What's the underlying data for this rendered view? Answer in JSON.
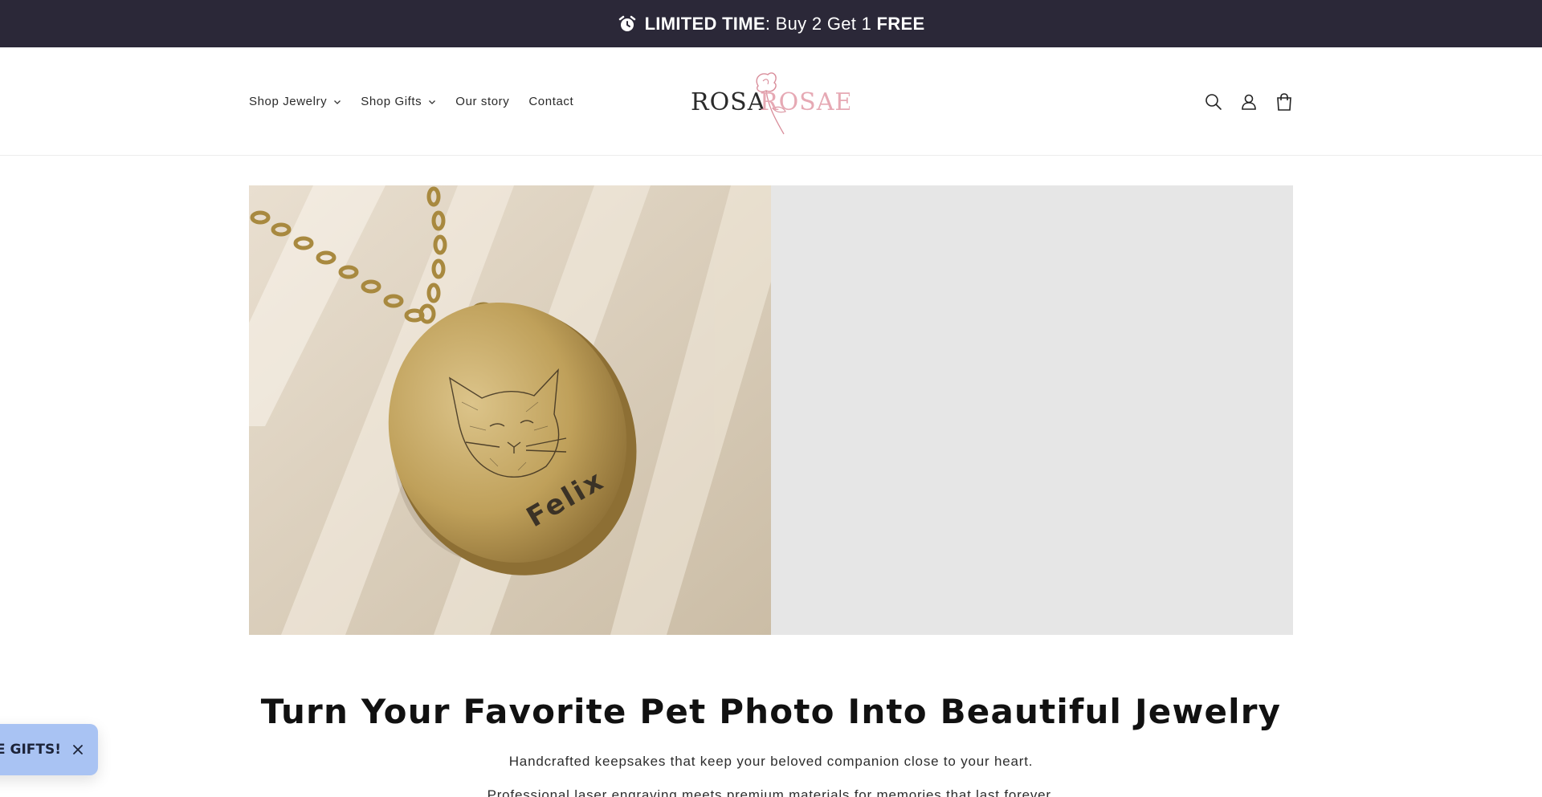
{
  "announcement": {
    "strong": "LIMITED TIME",
    "middle": ": Buy 2 Get 1 ",
    "strong2": "FREE",
    "icon": "alarm-clock-icon"
  },
  "nav": {
    "items": [
      {
        "label": "Shop Jewelry",
        "has_dropdown": true
      },
      {
        "label": "Shop Gifts",
        "has_dropdown": true
      },
      {
        "label": "Our story",
        "has_dropdown": false
      },
      {
        "label": "Contact",
        "has_dropdown": false
      }
    ]
  },
  "logo": {
    "part1": "ROSA",
    "part2": "ROSAE"
  },
  "header_icons": [
    "search-icon",
    "account-icon",
    "cart-icon"
  ],
  "hero": {
    "engraving": "Felix"
  },
  "content": {
    "headline": "Turn Your Favorite Pet Photo Into Beautiful Jewelry",
    "subtitle": "Handcrafted keepsakes that keep your beloved companion close to your heart.",
    "subtitle2": "Professional laser engraving meets premium materials for memories that last forever."
  },
  "gifts_badge": {
    "label": "REE GIFTS!"
  },
  "colors": {
    "announce_bg": "#2b2838",
    "gifts_bg": "#a9c3f3",
    "logo_pink": "#e6a9b4",
    "placeholder": "#e6e6e6"
  }
}
